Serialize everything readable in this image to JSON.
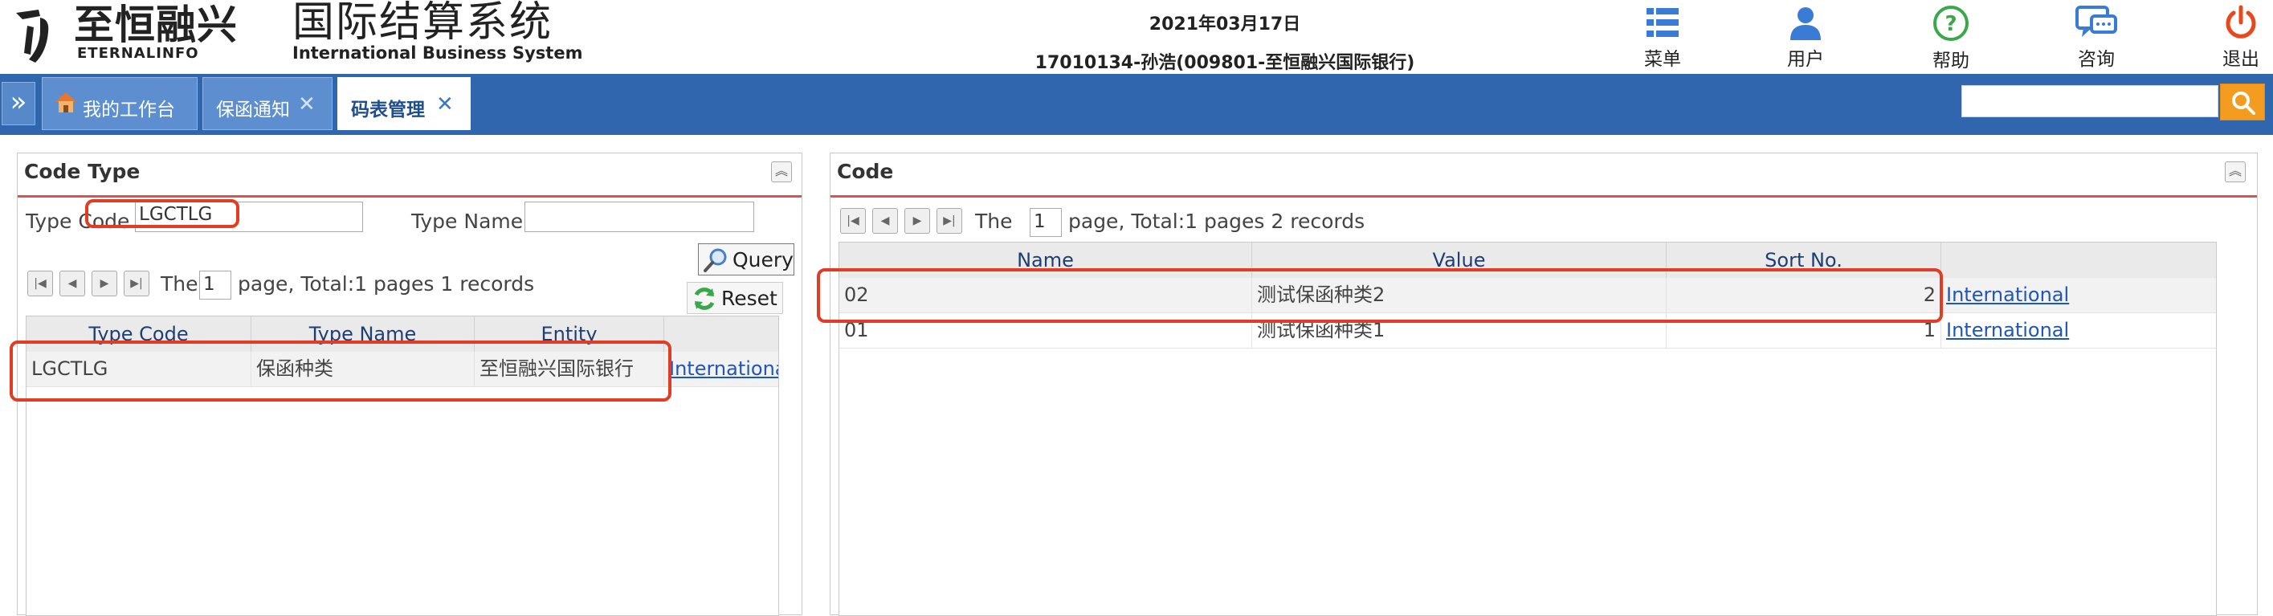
{
  "header": {
    "brand_cn": "至恒融兴",
    "brand_en": "ETERNALINFO",
    "system_cn": "国际结算系统",
    "system_en": "International Business System",
    "date": "2021年03月17日",
    "user": "17010134-孙浩(009801-至恒融兴国际银行)",
    "buttons": [
      {
        "label": "菜单",
        "icon": "menu-grid-icon"
      },
      {
        "label": "用户",
        "icon": "user-icon"
      },
      {
        "label": "帮助",
        "icon": "help-icon"
      },
      {
        "label": "咨询",
        "icon": "chat-icon"
      },
      {
        "label": "退出",
        "icon": "power-icon"
      }
    ]
  },
  "tabs": [
    {
      "label": "我的工作台",
      "icon": "home-icon",
      "closable": false
    },
    {
      "label": "保函通知",
      "closable": true
    },
    {
      "label": "码表管理",
      "closable": true,
      "active": true
    }
  ],
  "top_search": {
    "value": "",
    "icon": "search-icon"
  },
  "colors": {
    "nav": "#2f66ad",
    "accent": "#f39c1f",
    "highlight": "#e13d24"
  },
  "code_type_panel": {
    "title": "Code Type",
    "type_code_label": "Type Code",
    "type_code_value": "LGCTLG",
    "type_name_label": "Type Name",
    "type_name_value": "",
    "query_label": "Query",
    "reset_label": "Reset",
    "pager": {
      "prefix": "The",
      "page": "1",
      "summary": "page, Total:1 pages  1 records"
    },
    "columns": [
      "Type Code",
      "Type Name",
      "Entity",
      ""
    ],
    "rows": [
      {
        "type_code": "LGCTLG",
        "type_name": "保函种类",
        "entity": "至恒融兴国际银行",
        "link": "International"
      }
    ]
  },
  "code_panel": {
    "title": "Code",
    "pager": {
      "prefix": "The",
      "page": "1",
      "summary": "page, Total:1 pages  2 records"
    },
    "columns": [
      "Name",
      "Value",
      "Sort No.",
      ""
    ],
    "rows": [
      {
        "name": "02",
        "value": "测试保函种类2",
        "sort_no": "2",
        "link": "International"
      },
      {
        "name": "01",
        "value": "测试保函种类1",
        "sort_no": "1",
        "link": "International"
      }
    ]
  }
}
